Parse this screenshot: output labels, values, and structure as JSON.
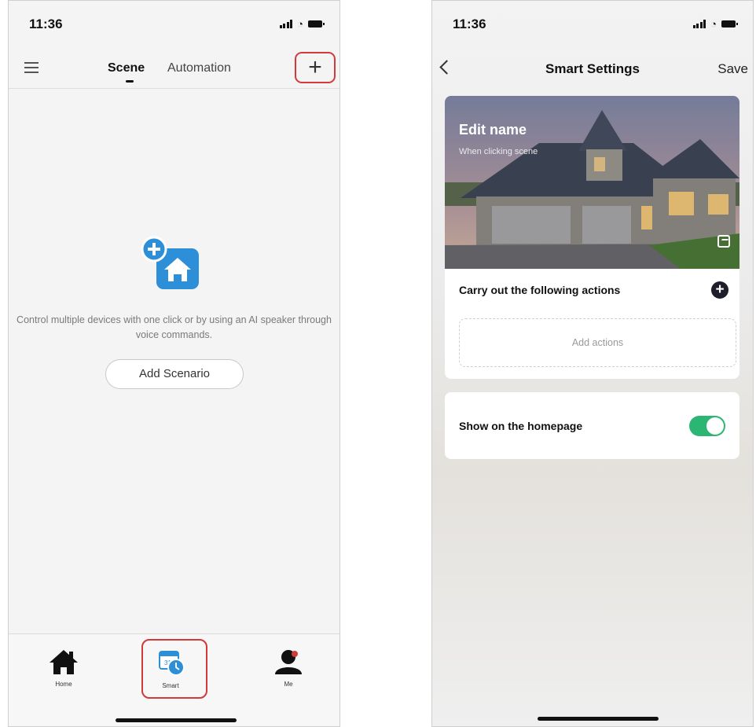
{
  "left_phone": {
    "status_time": "11:36",
    "header": {
      "tab_scene": "Scene",
      "tab_automation": "Automation",
      "add_symbol": "+"
    },
    "empty_state": {
      "message": "Control multiple devices with one click or by using an AI speaker through voice commands.",
      "button_label": "Add Scenario"
    },
    "tabbar": {
      "home_label": "Home",
      "smart_label": "Smart",
      "me_label": "Me"
    }
  },
  "right_phone": {
    "status_time": "11:36",
    "header": {
      "title": "Smart Settings",
      "save_label": "Save"
    },
    "scene_card": {
      "edit_name": "Edit name",
      "subtitle": "When clicking scene",
      "actions_title": "Carry out the following actions",
      "add_actions": "Add actions"
    },
    "homepage_card": {
      "label": "Show on the homepage",
      "toggle_on": true
    }
  },
  "colors": {
    "highlight_red": "#d23a3a",
    "toggle_green": "#2bb673",
    "icon_blue": "#2d8fd8"
  }
}
